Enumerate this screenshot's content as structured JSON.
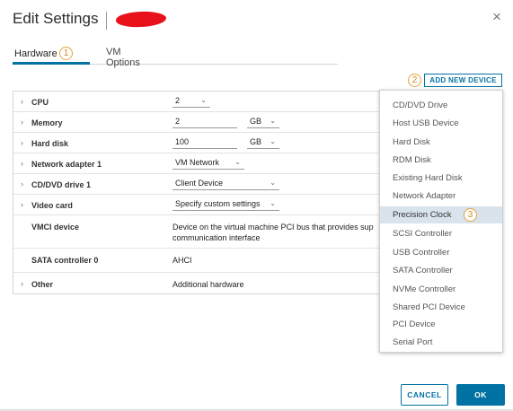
{
  "dialog": {
    "title": "Edit Settings",
    "close_glyph": "×"
  },
  "tabs": [
    {
      "label": "Hardware",
      "selected": true
    },
    {
      "label": "VM Options",
      "selected": false
    }
  ],
  "callouts": [
    "1",
    "2",
    "3"
  ],
  "add_device_label": "ADD NEW DEVICE",
  "hardware": {
    "cpu": {
      "label": "CPU",
      "value": "2"
    },
    "memory": {
      "label": "Memory",
      "value": "2",
      "unit": "GB"
    },
    "hard_disk": {
      "label": "Hard disk",
      "value": "100",
      "unit": "GB"
    },
    "network_adapter": {
      "label": "Network adapter 1",
      "value": "VM Network"
    },
    "cd_dvd": {
      "label": "CD/DVD drive 1",
      "value": "Client Device"
    },
    "video_card": {
      "label": "Video card",
      "value": "Specify custom settings"
    },
    "vmci": {
      "label": "VMCI device",
      "line1": "Device on the virtual machine PCI bus that provides sup",
      "line2": "communication interface"
    },
    "sata": {
      "label": "SATA controller 0",
      "value": "AHCI"
    },
    "other": {
      "label": "Other",
      "value": "Additional hardware"
    }
  },
  "device_menu": [
    "CD/DVD Drive",
    "Host USB Device",
    "Hard Disk",
    "RDM Disk",
    "Existing Hard Disk",
    "Network Adapter",
    "Precision Clock",
    "SCSI Controller",
    "USB Controller",
    "SATA Controller",
    "NVMe Controller",
    "Shared PCI Device",
    "PCI Device",
    "Serial Port"
  ],
  "device_menu_active": "Precision Clock",
  "footer": {
    "cancel_label": "CANCEL",
    "ok_label": "OK"
  },
  "colors": {
    "accent": "#0072a3",
    "callout": "#e8a13a",
    "menu_highlight": "#d8e3ec",
    "redaction": "#e8101a"
  },
  "icons": {
    "close": "close-icon",
    "expand": "chevron-right-icon",
    "dropdown": "chevron-down-icon"
  }
}
